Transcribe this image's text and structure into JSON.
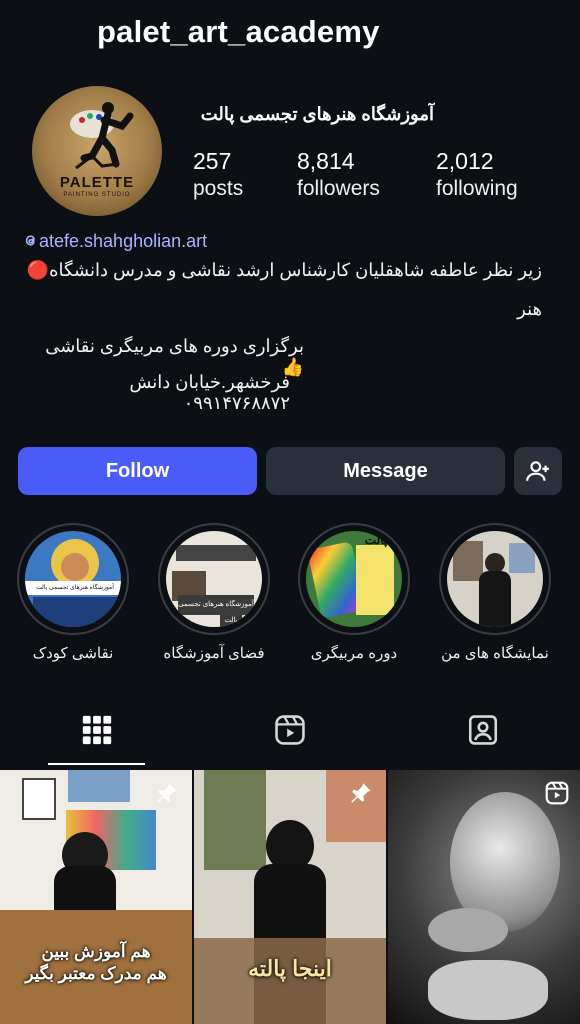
{
  "profile": {
    "username": "palet_art_academy",
    "full_name": "آموزشگاه هنرهای تجسمی پالت",
    "avatar_brand": "PALETTE",
    "avatar_brand_sub": "PAINTING STUDIO",
    "stats": {
      "posts": {
        "value": "257",
        "label": "posts"
      },
      "followers": {
        "value": "8,814",
        "label": "followers"
      },
      "following": {
        "value": "2,012",
        "label": "following"
      }
    },
    "link": "atefe.shahgholian.art",
    "bio_lines": [
      "زیر نظر عاطفه شاهقلیان کارشناس ارشد نقاشی و مدرس دانشگاه🔴",
      "هنر",
      "برگزاری دوره های مربیگری نقاشی👍",
      "فرخشهر.خیابان دانش ۰۹۹۱۴۷۶۸۸۷۲"
    ]
  },
  "actions": {
    "follow_label": "Follow",
    "message_label": "Message",
    "add_person_icon": "add-person-icon"
  },
  "highlights": [
    {
      "label": "نمایشگاه های من"
    },
    {
      "label": "دوره مربیگری"
    },
    {
      "label": "فضای آموزشگاه"
    },
    {
      "label": "نقاشی کودک"
    }
  ],
  "highlight_texts": {
    "kids_title": "آموزشگاه هنرهای تجسمی پالت",
    "space_sign": "آموزشگاه هنرهای تجسمی پالت",
    "space_sub": "پالت",
    "course_title": "پالت"
  },
  "tabs": [
    {
      "icon": "grid-icon",
      "active": true
    },
    {
      "icon": "reels-icon",
      "active": false
    },
    {
      "icon": "tagged-icon",
      "active": false
    }
  ],
  "posts": [
    {
      "caption_line1": "هم آموزش ببین",
      "caption_line2": "هم مدرک معتبر بگیر",
      "pinned": true
    },
    {
      "caption_line1": "اینجا پالته",
      "pinned": true
    },
    {
      "pinned": false,
      "reel": true
    }
  ],
  "colors": {
    "background": "#0c0f14",
    "follow_button": "#4a5cf7",
    "secondary_button": "#2b2f38",
    "link": "#a9b6ff"
  }
}
